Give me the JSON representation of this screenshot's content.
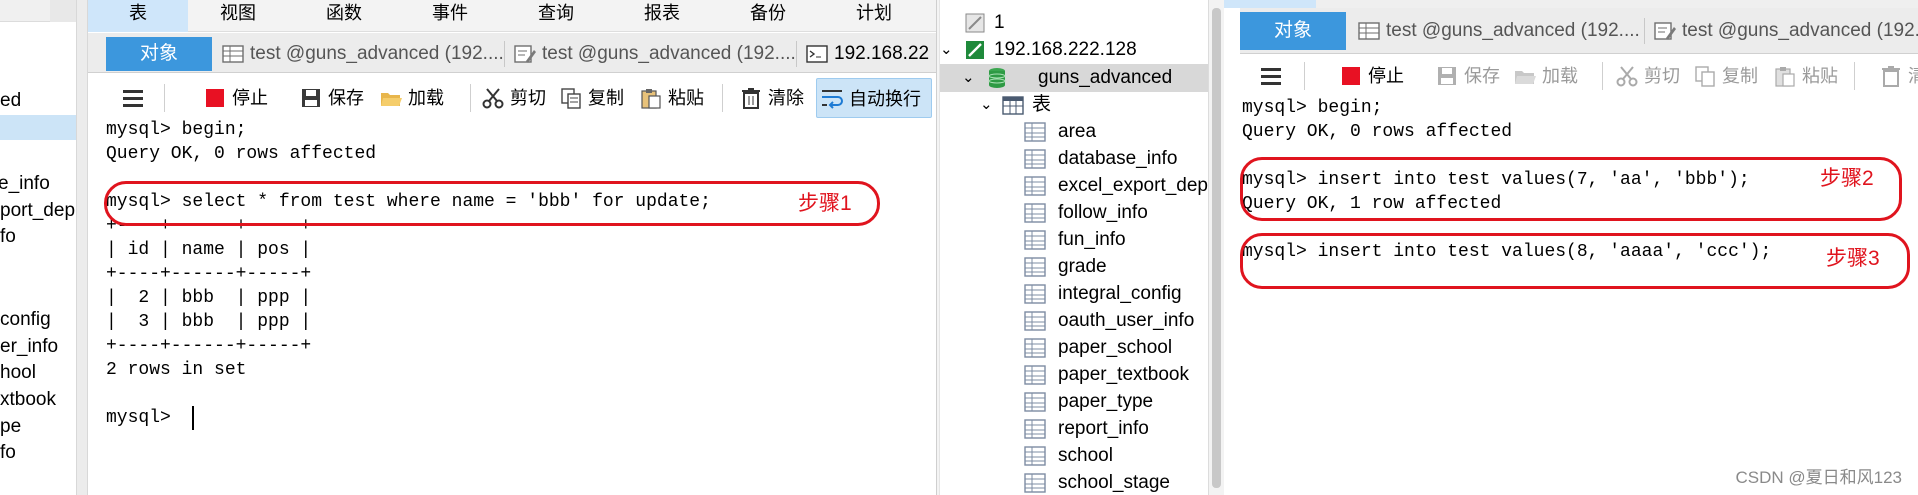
{
  "left_strip": {
    "items": [
      "ed",
      "e_info",
      "port_dep",
      "fo",
      "config",
      "er_info",
      "hool",
      "xtbook",
      "pe",
      "fo"
    ]
  },
  "left_window": {
    "menu": [
      "表",
      "视图",
      "函数",
      "事件",
      "查询",
      "报表",
      "备份",
      "计划"
    ],
    "tabs": {
      "object": "对象",
      "tab1": "test @guns_advanced (192....",
      "tab2": "test @guns_advanced (192....",
      "tab3": "192.168.22"
    },
    "toolbar": {
      "stop": "停止",
      "save": "保存",
      "load": "加载",
      "cut": "剪切",
      "copy": "复制",
      "paste": "粘贴",
      "clear": "清除",
      "wrap": "自动换行"
    },
    "console": [
      "mysql> begin;",
      "Query OK, 0 rows affected",
      "",
      "mysql> select * from test where name = 'bbb' for update;",
      "+----+------+-----+",
      "| id | name | pos |",
      "+----+------+-----+",
      "|  2 | bbb  | ppp |",
      "|  3 | bbb  | ppp |",
      "+----+------+-----+",
      "2 rows in set",
      "",
      "mysql> "
    ]
  },
  "navigator": {
    "items": [
      {
        "label": "1",
        "icon": "connection-icon"
      },
      {
        "label": "192.168.222.128",
        "icon": "mysql-connection-icon"
      },
      {
        "label": "guns_advanced",
        "icon": "database-icon"
      },
      {
        "label": "表",
        "icon": "tables-folder-icon"
      },
      {
        "label": "area",
        "icon": "table-icon"
      },
      {
        "label": "database_info",
        "icon": "table-icon"
      },
      {
        "label": "excel_export_dep",
        "icon": "table-icon"
      },
      {
        "label": "follow_info",
        "icon": "table-icon"
      },
      {
        "label": "fun_info",
        "icon": "table-icon"
      },
      {
        "label": "grade",
        "icon": "table-icon"
      },
      {
        "label": "integral_config",
        "icon": "table-icon"
      },
      {
        "label": "oauth_user_info",
        "icon": "table-icon"
      },
      {
        "label": "paper_school",
        "icon": "table-icon"
      },
      {
        "label": "paper_textbook",
        "icon": "table-icon"
      },
      {
        "label": "paper_type",
        "icon": "table-icon"
      },
      {
        "label": "report_info",
        "icon": "table-icon"
      },
      {
        "label": "school",
        "icon": "table-icon"
      },
      {
        "label": "school_stage",
        "icon": "table-icon"
      }
    ]
  },
  "right_window": {
    "tabs": {
      "object": "对象",
      "tab1": "test @guns_advanced (192....",
      "tab2": "test @guns_advanced (192...."
    },
    "toolbar": {
      "stop": "停止",
      "save": "保存",
      "load": "加载",
      "cut": "剪切",
      "copy": "复制",
      "paste": "粘贴",
      "clear": "清"
    },
    "console": [
      "mysql> begin;",
      "Query OK, 0 rows affected",
      "",
      "mysql> insert into test values(7, 'aa', 'bbb');",
      "Query OK, 1 row affected",
      "",
      "mysql> insert into test values(8, 'aaaa', 'ccc');"
    ]
  },
  "annotations": {
    "step1": "步骤1",
    "step2": "步骤2",
    "step3": "步骤3"
  },
  "watermark": "CSDN @夏日和风123",
  "colors": {
    "accent_tab": "#3c97dd",
    "menu_active": "#cfe6fa",
    "annotation_red": "#e0141e"
  }
}
